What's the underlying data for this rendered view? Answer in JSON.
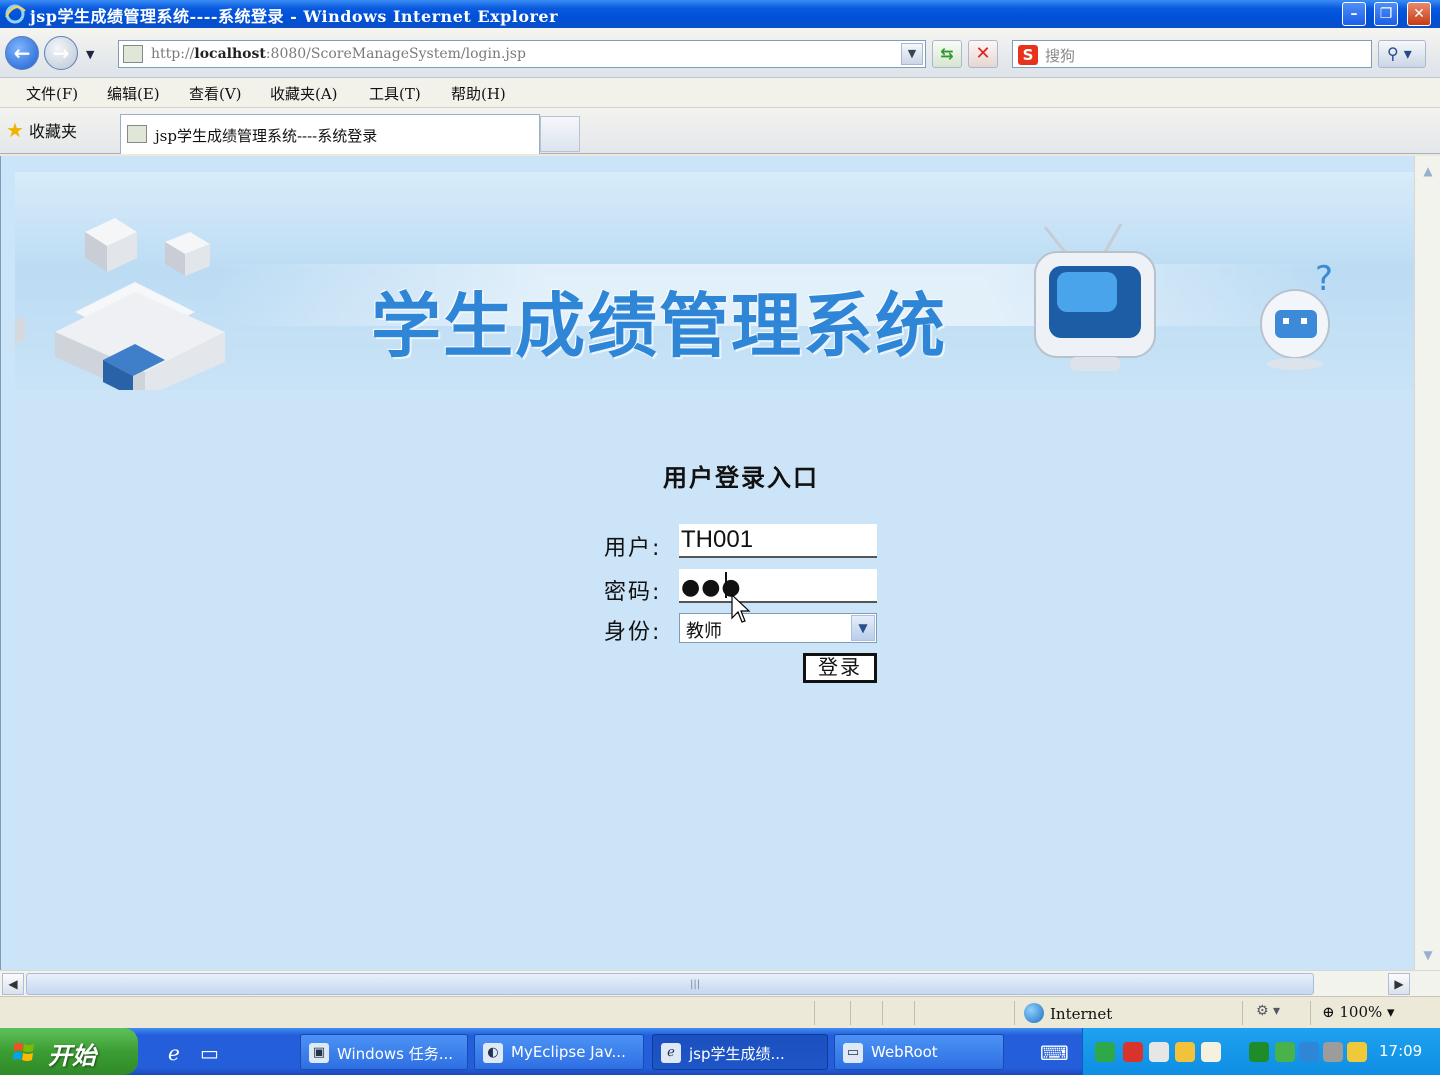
{
  "window": {
    "title": "jsp学生成绩管理系统----系统登录 - Windows Internet Explorer",
    "controls": {
      "minimize": "–",
      "restore": "❐",
      "close": "✕"
    }
  },
  "address_bar": {
    "url_prefix": "http://",
    "url_host": "localhost",
    "url_rest": ":8080/ScoreManageSystem/login.jsp",
    "search_placeholder": "搜狗",
    "search_logo": "S"
  },
  "menu": [
    "文件(F)",
    "编辑(E)",
    "查看(V)",
    "收藏夹(A)",
    "工具(T)",
    "帮助(H)"
  ],
  "favorites_label": "收藏夹",
  "tab": {
    "title": "jsp学生成绩管理系统----系统登录"
  },
  "banner": {
    "title": "学生成绩管理系统"
  },
  "login": {
    "heading": "用户登录入口",
    "user_label": "用户:",
    "user_value": "TH001",
    "password_label": "密码:",
    "password_mask": "●●●",
    "role_label": "身份:",
    "role_value": "教师",
    "submit_label": "登录"
  },
  "status_bar": {
    "zone": "Internet",
    "zoom": "100%"
  },
  "taskbar": {
    "start_label": "开始",
    "tasks": [
      {
        "label": "Windows 任务...",
        "icon": "task-manager-icon",
        "active": false
      },
      {
        "label": "MyEclipse Jav...",
        "icon": "eclipse-icon",
        "active": false
      },
      {
        "label": "jsp学生成绩...",
        "icon": "ie-icon",
        "active": true
      },
      {
        "label": "WebRoot",
        "icon": "folder-icon",
        "active": false
      }
    ],
    "clock": "17:09"
  },
  "colors": {
    "content_bg": "#cce4f7",
    "banner_title": "#2f86d6",
    "titlebar": "#0a5adf",
    "taskbar": "#245edb",
    "start": "#3c9d34"
  }
}
